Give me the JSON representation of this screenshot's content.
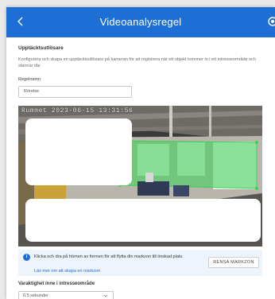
{
  "header": {
    "title": "Videoanalysregel",
    "back_icon": "chevron-left-icon",
    "settings_icon": "gear-icon",
    "color": "#1d6fd6"
  },
  "detector": {
    "section_title": "Upptäcktsutlösare",
    "description": "Konfigurera och skapa en upptäcktsutlösare på kameran för att registrera när ett objekt kommer in i ett intresseområde och stannar där."
  },
  "rule_name": {
    "label": "Regelnamn",
    "value": "Rörelse"
  },
  "video": {
    "timestamp": "Rummet 2023-06-15 13:31:56",
    "zone_color": "#39d353"
  },
  "info": {
    "text": "Klicka och dra på hörnen av formen för att flytta din markzon till önskad plats.",
    "link": "Läs mer om att skapa en markzon",
    "clear_button": "RENSA MARKZON",
    "icon": "info-icon"
  },
  "duration": {
    "title": "Varaktighet inne i intresseområde",
    "selected": "0.5 sekunder",
    "chevron_icon": "chevron-down-icon"
  }
}
